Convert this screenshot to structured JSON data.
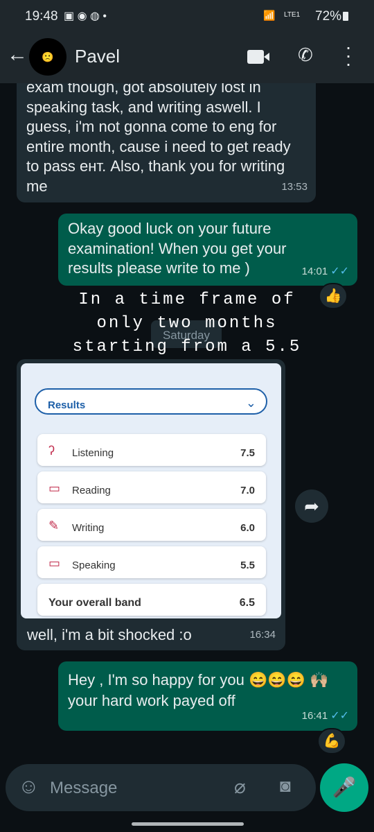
{
  "status_bar": {
    "time": "19:48",
    "battery": "72%",
    "network": "LTE1"
  },
  "header": {
    "contact_name": "Pavel",
    "icons": [
      "back-arrow-icon",
      "video-call-icon",
      "phone-icon",
      "more-vert-icon"
    ]
  },
  "messages": [
    {
      "direction": "incoming",
      "text": "exam though, got absolutely lost in speaking task, and writing aswell. I guess, i'm not gonna come to eng for entire month, cause i need to get ready to pass ент. Also, thank you for writing me",
      "time": "13:53"
    },
    {
      "direction": "outgoing",
      "text": "Okay good luck on your future examination! When you get your results please write to me )",
      "time": "14:01",
      "reaction": "👍"
    },
    {
      "direction": "incoming",
      "caption": "well, i'm a bit shocked :o",
      "time": "16:34"
    },
    {
      "direction": "outgoing",
      "text": "Hey , I'm so happy for you 😄😄😄 🙌🏼 your hard work payed off",
      "time": "16:41",
      "reaction": "💪"
    }
  ],
  "overlay_text": [
    "In a time frame of",
    "only two months",
    "starting from a 5.5"
  ],
  "date_chip": "Saturday",
  "results": {
    "title": "Results",
    "rows": [
      {
        "label": "Listening",
        "score": "7.5"
      },
      {
        "label": "Reading",
        "score": "7.0"
      },
      {
        "label": "Writing",
        "score": "6.0"
      },
      {
        "label": "Speaking",
        "score": "5.5"
      }
    ],
    "overall_label": "Your overall band",
    "overall_score": "6.5"
  },
  "composer": {
    "placeholder": "Message"
  }
}
